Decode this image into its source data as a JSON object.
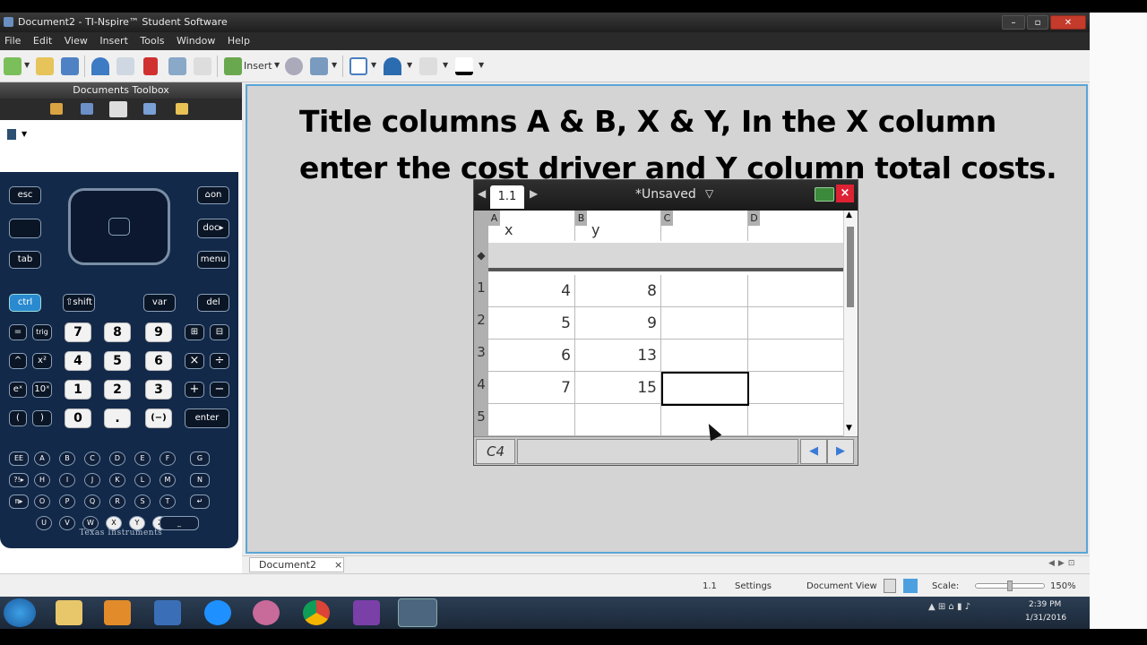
{
  "window": {
    "title": "Document2 - TI-Nspire™ Student Software",
    "minimize": "–",
    "maximize": "▫",
    "close": "✕"
  },
  "menu": [
    "File",
    "Edit",
    "View",
    "Insert",
    "Tools",
    "Window",
    "Help"
  ],
  "toolbar": {
    "insert_label": "Insert"
  },
  "toolbox": {
    "header": "Documents Toolbox"
  },
  "calculator": {
    "keys": {
      "esc": "esc",
      "tab": "tab",
      "on": "⌂on",
      "doc": "doc▸",
      "menu": "menu",
      "ctrl": "ctrl",
      "shift": "⇧shift",
      "var": "var",
      "del": "del",
      "n7": "7",
      "n8": "8",
      "n9": "9",
      "n4": "4",
      "n5": "5",
      "n6": "6",
      "n1": "1",
      "n2": "2",
      "n3": "3",
      "n0": "0",
      "dot": ".",
      "neg": "(−)",
      "enter": "enter",
      "eq": "=",
      "trig": "trig",
      "caret": "^",
      "x2": "x²",
      "ex": "eˣ",
      "tenx": "10ˣ",
      "lp": "(",
      "rp": ")",
      "mul": "×",
      "div": "÷",
      "plus": "+",
      "minus": "−",
      "temp": "⊞",
      "frac": "⊟",
      "row1": [
        "EE",
        "A",
        "B",
        "C",
        "D",
        "E",
        "F",
        "G"
      ],
      "row2": [
        "?!▸",
        "H",
        "I",
        "J",
        "K",
        "L",
        "M",
        "N"
      ],
      "row3": [
        "π▸",
        "O",
        "P",
        "Q",
        "R",
        "S",
        "T",
        "↵"
      ],
      "row4": [
        "U",
        "V",
        "W",
        "X",
        "Y",
        "Z",
        "_"
      ]
    },
    "logo": "Texas Instruments"
  },
  "slide": {
    "line1": "Title columns A & B, X & Y,  In the X column",
    "line2": "enter the cost driver and Y column total costs."
  },
  "handheld": {
    "tab": "1.1",
    "title": "*Unsaved",
    "close": "×",
    "columns": [
      {
        "letter": "A",
        "name": "x"
      },
      {
        "letter": "B",
        "name": "y"
      },
      {
        "letter": "C",
        "name": ""
      },
      {
        "letter": "D",
        "name": ""
      }
    ],
    "formula_row_marker": "◆",
    "rows": [
      {
        "num": "1",
        "a": "4",
        "b": "8"
      },
      {
        "num": "2",
        "a": "5",
        "b": "9"
      },
      {
        "num": "3",
        "a": "6",
        "b": "13"
      },
      {
        "num": "4",
        "a": "7",
        "b": "15"
      },
      {
        "num": "5",
        "a": "",
        "b": ""
      }
    ],
    "cell_ref": "C4",
    "nav_left": "◀",
    "nav_right": "▶"
  },
  "doc_tab": {
    "label": "Document2",
    "close": "×"
  },
  "statusbar": {
    "page": "1.1",
    "settings": "Settings",
    "view": "Document View",
    "scale": "Scale:",
    "zoom": "150%"
  },
  "clock": {
    "time": "2:39 PM",
    "date": "1/31/2016"
  },
  "colors": {
    "accent": "#5aa5d6",
    "calc_body": "#13294a",
    "close_red": "#c43b2b"
  }
}
